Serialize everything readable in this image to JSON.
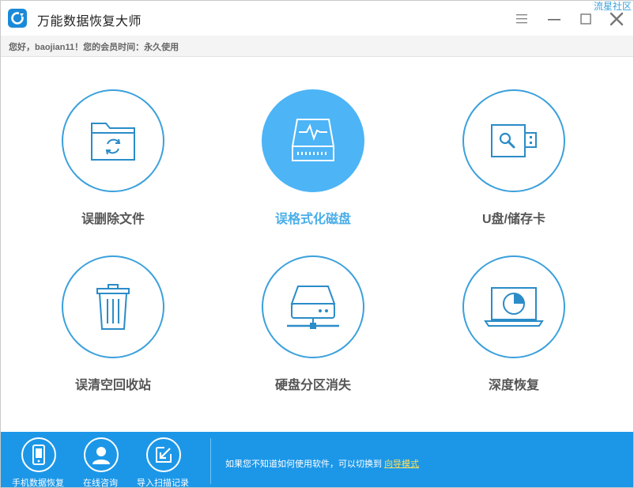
{
  "app": {
    "title": "万能数据恢复大师",
    "watermark": "流星社区"
  },
  "greeting": "您好，baojian11！您的会员时间：永久使用",
  "tiles": [
    {
      "label": "误删除文件",
      "icon": "folder-recycle-icon"
    },
    {
      "label": "误格式化磁盘",
      "icon": "disk-pulse-icon",
      "selected": true
    },
    {
      "label": "U盘/储存卡",
      "icon": "usb-drive-icon"
    },
    {
      "label": "误清空回收站",
      "icon": "trash-bin-icon"
    },
    {
      "label": "硬盘分区消失",
      "icon": "network-drive-icon"
    },
    {
      "label": "深度恢复",
      "icon": "laptop-scan-icon"
    }
  ],
  "footer": {
    "buttons": [
      {
        "label": "手机数据恢复",
        "icon": "phone-icon"
      },
      {
        "label": "在线咨询",
        "icon": "user-avatar-icon"
      },
      {
        "label": "导入扫描记录",
        "icon": "import-icon"
      }
    ],
    "hint_text": "如果您不知道如何使用软件，可以切换到",
    "link_text": "向导模式"
  },
  "colors": {
    "accent": "#3aa0dc",
    "selected_fill": "#4db4f6",
    "footer_bg": "#1c97e8",
    "link": "#ffe15a"
  }
}
